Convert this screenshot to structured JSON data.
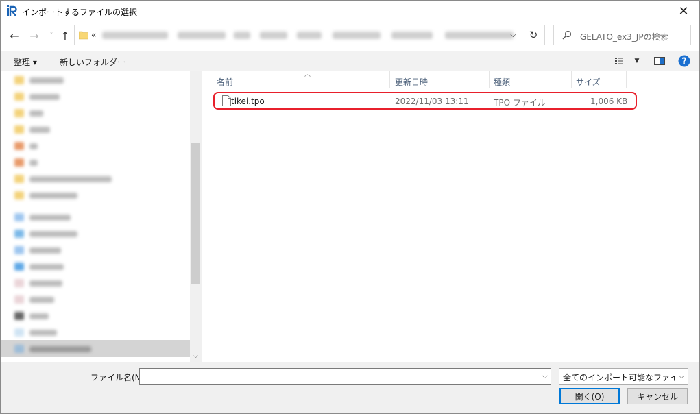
{
  "window": {
    "title": "インポートするファイルの選択"
  },
  "nav": {
    "address_prefix": "«",
    "search_placeholder": "GELATO_ex3_JPの検索"
  },
  "toolbar": {
    "organize_label": "整理 ▾",
    "new_folder_label": "新しいフォルダー"
  },
  "columns": {
    "name": "名前",
    "modified": "更新日時",
    "type": "種類",
    "size": "サイズ"
  },
  "files": [
    {
      "name": "tikei.tpo",
      "modified": "2022/11/03 13:11",
      "type": "TPO ファイル",
      "size": "1,006 KB"
    }
  ],
  "bottom": {
    "filename_label": "ファイル名(N):",
    "filename_value": "",
    "filetype_value": "全てのインポート可能なファイル (*.tpo",
    "open_label": "開く(O)",
    "cancel_label": "キャンセル"
  },
  "colors": {
    "highlight": "#e8202c",
    "accent": "#0078d7"
  }
}
